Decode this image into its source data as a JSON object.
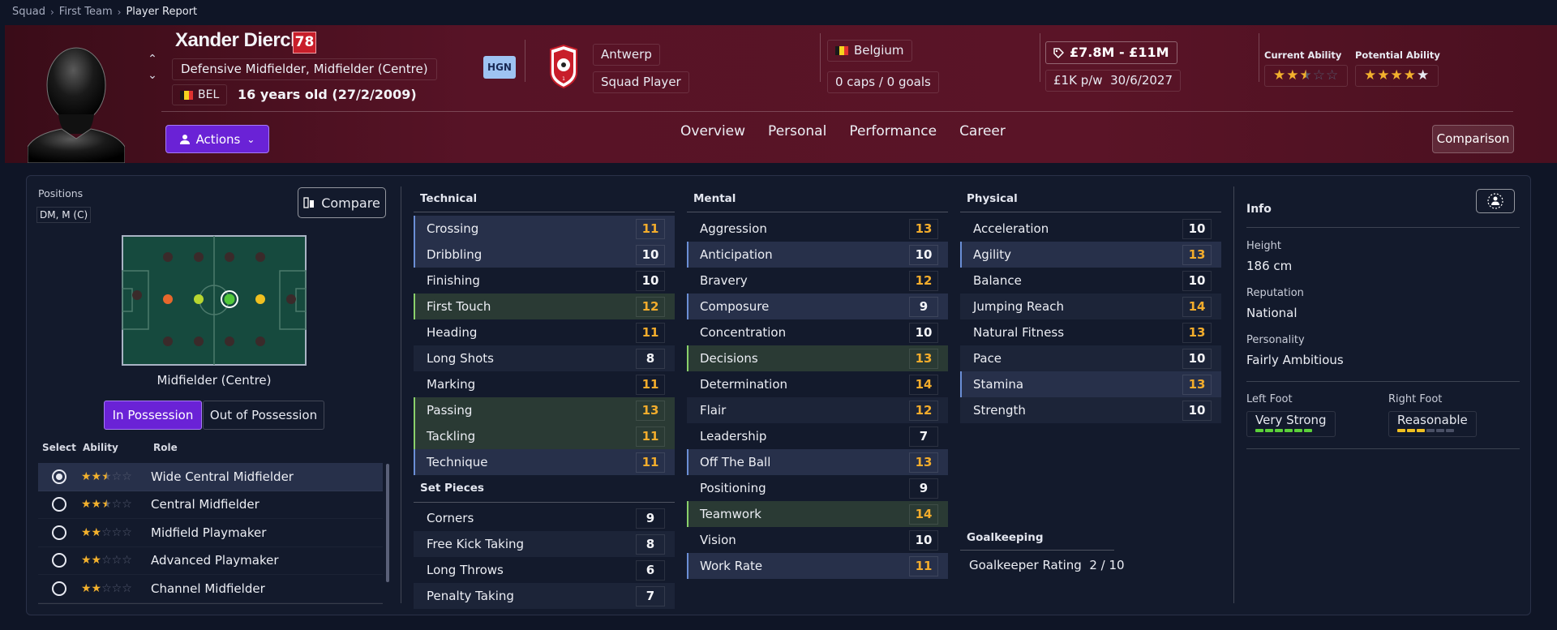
{
  "breadcrumb": [
    "Squad",
    "First Team",
    "Player Report"
  ],
  "player": {
    "name": "Xander Dierckx",
    "rating": "78",
    "positions_text": "Defensive Midfielder, Midfielder (Centre)",
    "nationality_code": "BEL",
    "age_text": "16 years old (27/2/2009)",
    "hgn_badge": "HGN",
    "club": "Antwerp",
    "squad_status": "Squad Player",
    "country": "Belgium",
    "caps_goals": "0 caps / 0 goals",
    "value": "£7.8M - £11M",
    "wage": "£1K p/w",
    "contract_end": "30/6/2027",
    "current_ability_label": "Current Ability",
    "current_ability_stars": 2.5,
    "potential_ability_label": "Potential Ability",
    "potential_ability_stars": 4.5
  },
  "colors": {
    "accent": "#6a22d6",
    "header_bg": "#571326",
    "gold": "#f2ac2c",
    "belgium": [
      "#1a1a1a",
      "#f5d31f",
      "#e0322f"
    ]
  },
  "actions_label": "Actions",
  "tabs": [
    "Overview",
    "Personal",
    "Performance",
    "Career"
  ],
  "comparison_label": "Comparison",
  "positions": {
    "label": "Positions",
    "chip": "DM, M (C)",
    "compare_label": "Compare",
    "caption": "Midfielder (Centre)",
    "in_possession": "In Possession",
    "out_possession": "Out of Possession"
  },
  "roles": {
    "headers": [
      "Select",
      "Ability",
      "Role"
    ],
    "items": [
      {
        "name": "Wide Central Midfielder",
        "stars": 2.5,
        "selected": true
      },
      {
        "name": "Central Midfielder",
        "stars": 2.5,
        "selected": false
      },
      {
        "name": "Midfield Playmaker",
        "stars": 2,
        "selected": false
      },
      {
        "name": "Advanced Playmaker",
        "stars": 2,
        "selected": false
      },
      {
        "name": "Channel Midfielder",
        "stars": 2,
        "selected": false
      }
    ]
  },
  "technical": {
    "title": "Technical",
    "items": [
      {
        "name": "Crossing",
        "value": 11,
        "hl": "blue"
      },
      {
        "name": "Dribbling",
        "value": 10,
        "hl": "blue"
      },
      {
        "name": "Finishing",
        "value": 10,
        "hl": ""
      },
      {
        "name": "First Touch",
        "value": 12,
        "hl": "green"
      },
      {
        "name": "Heading",
        "value": 11,
        "hl": ""
      },
      {
        "name": "Long Shots",
        "value": 8,
        "hl": ""
      },
      {
        "name": "Marking",
        "value": 11,
        "hl": ""
      },
      {
        "name": "Passing",
        "value": 13,
        "hl": "green"
      },
      {
        "name": "Tackling",
        "value": 11,
        "hl": "green"
      },
      {
        "name": "Technique",
        "value": 11,
        "hl": "blue"
      }
    ]
  },
  "set_pieces": {
    "title": "Set Pieces",
    "items": [
      {
        "name": "Corners",
        "value": 9,
        "hl": ""
      },
      {
        "name": "Free Kick Taking",
        "value": 8,
        "hl": ""
      },
      {
        "name": "Long Throws",
        "value": 6,
        "hl": ""
      },
      {
        "name": "Penalty Taking",
        "value": 7,
        "hl": ""
      }
    ]
  },
  "mental": {
    "title": "Mental",
    "items": [
      {
        "name": "Aggression",
        "value": 13,
        "hl": ""
      },
      {
        "name": "Anticipation",
        "value": 10,
        "hl": "blue"
      },
      {
        "name": "Bravery",
        "value": 12,
        "hl": ""
      },
      {
        "name": "Composure",
        "value": 9,
        "hl": "blue"
      },
      {
        "name": "Concentration",
        "value": 10,
        "hl": ""
      },
      {
        "name": "Decisions",
        "value": 13,
        "hl": "green"
      },
      {
        "name": "Determination",
        "value": 14,
        "hl": ""
      },
      {
        "name": "Flair",
        "value": 12,
        "hl": ""
      },
      {
        "name": "Leadership",
        "value": 7,
        "hl": ""
      },
      {
        "name": "Off The Ball",
        "value": 13,
        "hl": "blue"
      },
      {
        "name": "Positioning",
        "value": 9,
        "hl": ""
      },
      {
        "name": "Teamwork",
        "value": 14,
        "hl": "green"
      },
      {
        "name": "Vision",
        "value": 10,
        "hl": ""
      },
      {
        "name": "Work Rate",
        "value": 11,
        "hl": "blue"
      }
    ]
  },
  "physical": {
    "title": "Physical",
    "items": [
      {
        "name": "Acceleration",
        "value": 10,
        "hl": ""
      },
      {
        "name": "Agility",
        "value": 13,
        "hl": "blue"
      },
      {
        "name": "Balance",
        "value": 10,
        "hl": ""
      },
      {
        "name": "Jumping Reach",
        "value": 14,
        "hl": ""
      },
      {
        "name": "Natural Fitness",
        "value": 13,
        "hl": ""
      },
      {
        "name": "Pace",
        "value": 10,
        "hl": ""
      },
      {
        "name": "Stamina",
        "value": 13,
        "hl": "blue"
      },
      {
        "name": "Strength",
        "value": 10,
        "hl": ""
      }
    ]
  },
  "goalkeeping": {
    "title": "Goalkeeping",
    "rating_label": "Goalkeeper Rating",
    "rating_value": "2 / 10"
  },
  "info": {
    "title": "Info",
    "height_label": "Height",
    "height": "186 cm",
    "reputation_label": "Reputation",
    "reputation": "National",
    "personality_label": "Personality",
    "personality": "Fairly Ambitious",
    "left_foot_label": "Left Foot",
    "left_foot": "Very Strong",
    "left_foot_level": 6,
    "right_foot_label": "Right Foot",
    "right_foot": "Reasonable",
    "right_foot_level": 3
  }
}
